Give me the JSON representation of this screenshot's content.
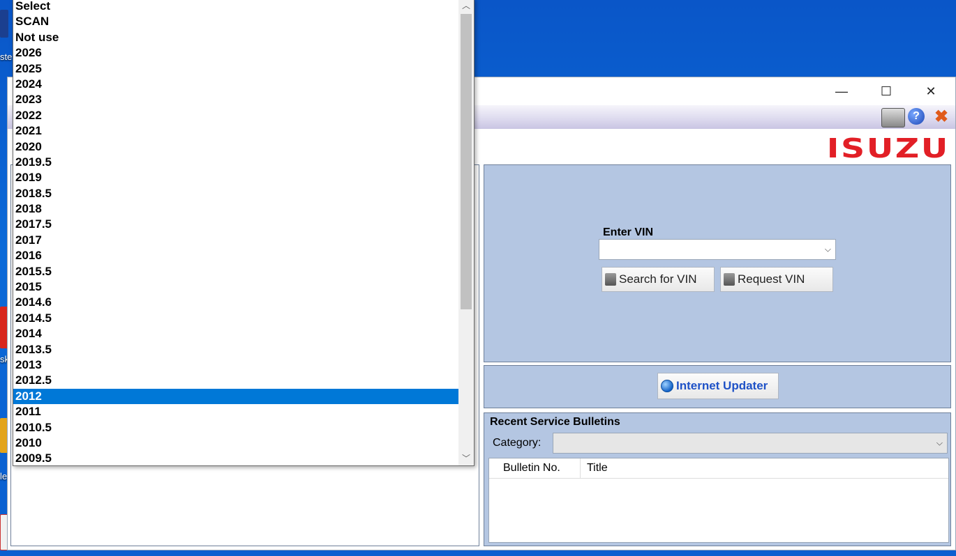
{
  "window": {
    "controls": {
      "minimize": "—",
      "maximize": "☐",
      "close": "✕"
    }
  },
  "brand": {
    "logo_text": "ISUZU",
    "color": "#e21f26"
  },
  "desktop": {
    "labels": [
      "ste",
      "sk",
      "le"
    ]
  },
  "vin": {
    "label": "Enter VIN",
    "value": "",
    "search_label": "Search for VIN",
    "request_label": "Request VIN"
  },
  "updater": {
    "label": "Internet Updater"
  },
  "bulletins": {
    "title": "Recent Service Bulletins",
    "category_label": "Category:",
    "category_value": "",
    "columns": [
      "Bulletin No.",
      "Title"
    ]
  },
  "dropdown": {
    "selected": "2012",
    "options": [
      "Select",
      "SCAN",
      "Not use",
      "2026",
      "2025",
      "2024",
      "2023",
      "2022",
      "2021",
      "2020",
      "2019.5",
      "2019",
      "2018.5",
      "2018",
      "2017.5",
      "2017",
      "2016",
      "2015.5",
      "2015",
      "2014.6",
      "2014.5",
      "2014",
      "2013.5",
      "2013",
      "2012.5",
      "2012",
      "2011",
      "2010.5",
      "2010",
      "2009.5"
    ]
  },
  "colors": {
    "selection": "#0078d7",
    "panel": "#b4c6e2",
    "desktop": "#0a5fd0"
  }
}
